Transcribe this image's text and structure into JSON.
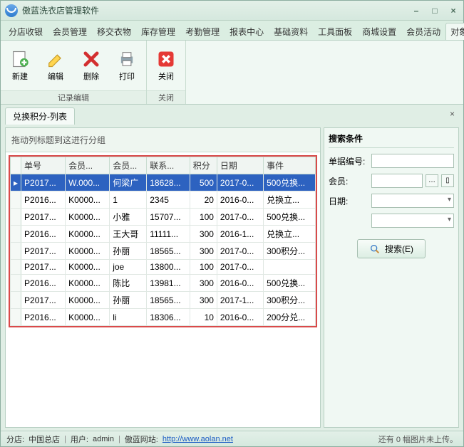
{
  "title": "傲蓝洗衣店管理软件",
  "tabs": [
    "分店收银",
    "会员管理",
    "移交衣物",
    "库存管理",
    "考勤管理",
    "报表中心",
    "基础资料",
    "工具面板",
    "商城设置",
    "会员活动",
    "对象列"
  ],
  "active_tab": 10,
  "ribbon": {
    "groups": [
      {
        "label": "记录编辑",
        "buttons": [
          {
            "name": "new",
            "label": "新建"
          },
          {
            "name": "edit",
            "label": "编辑"
          },
          {
            "name": "delete",
            "label": "删除"
          },
          {
            "name": "print",
            "label": "打印"
          }
        ]
      },
      {
        "label": "关闭",
        "buttons": [
          {
            "name": "close",
            "label": "关闭"
          }
        ]
      }
    ]
  },
  "subtab": {
    "label": "兑换积分-列表"
  },
  "group_hint": "拖动列标题到这进行分组",
  "columns": [
    "单号",
    "会员...",
    "会员...",
    "联系...",
    "积分",
    "日期",
    "事件"
  ],
  "rows": [
    {
      "c": [
        "P2017...",
        "W.000...",
        "何梁广",
        "18628...",
        "500",
        "2017-0...",
        "500兑换..."
      ],
      "sel": true
    },
    {
      "c": [
        "P2016...",
        "K0000...",
        "1",
        "2345",
        "20",
        "2016-0...",
        "兑换立..."
      ]
    },
    {
      "c": [
        "P2017...",
        "K0000...",
        "小雅",
        "15707...",
        "100",
        "2017-0...",
        "500兑换..."
      ]
    },
    {
      "c": [
        "P2016...",
        "K0000...",
        "王大哥",
        "11111...",
        "300",
        "2016-1...",
        "兑换立..."
      ]
    },
    {
      "c": [
        "P2017...",
        "K0000...",
        "孙丽",
        "18565...",
        "300",
        "2017-0...",
        "300积分..."
      ]
    },
    {
      "c": [
        "P2017...",
        "K0000...",
        "joe",
        "13800...",
        "100",
        "2017-0...",
        ""
      ]
    },
    {
      "c": [
        "P2016...",
        "K0000...",
        "陈比",
        "13981...",
        "300",
        "2016-0...",
        "500兑换..."
      ]
    },
    {
      "c": [
        "P2017...",
        "K0000...",
        "孙丽",
        "18565...",
        "300",
        "2017-1...",
        "300积分..."
      ]
    },
    {
      "c": [
        "P2016...",
        "K0000...",
        "li",
        "18306...",
        "10",
        "2016-0...",
        "200分兑..."
      ]
    }
  ],
  "search": {
    "header": "搜索条件",
    "order_label": "单据编号:",
    "member_label": "会员:",
    "date_label": "日期:",
    "button": "搜索(E)"
  },
  "status": {
    "store_label": "分店:",
    "store": "中国总店",
    "user_label": "用户:",
    "user": "admin",
    "site_label": "傲蓝网站:",
    "url": "http://www.aolan.net",
    "upload": "还有 0 幅图片未上传。"
  }
}
